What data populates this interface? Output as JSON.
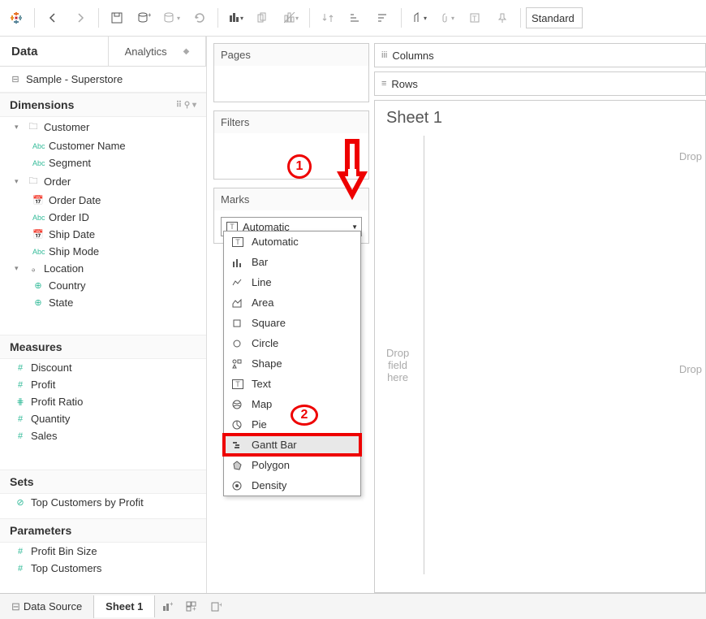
{
  "toolbar": {
    "style_select": "Standard"
  },
  "side": {
    "tabs": {
      "data": "Data",
      "analytics": "Analytics"
    },
    "datasource": "Sample - Superstore",
    "dimensions_label": "Dimensions",
    "dimensions": {
      "customer": "Customer",
      "customer_name": "Customer Name",
      "segment": "Segment",
      "order": "Order",
      "order_date": "Order Date",
      "order_id": "Order ID",
      "ship_date": "Ship Date",
      "ship_mode": "Ship Mode",
      "location": "Location",
      "country": "Country",
      "state": "State"
    },
    "measures_label": "Measures",
    "measures": {
      "discount": "Discount",
      "profit": "Profit",
      "profit_ratio": "Profit Ratio",
      "quantity": "Quantity",
      "sales": "Sales"
    },
    "sets_label": "Sets",
    "sets": {
      "top_cust": "Top Customers by Profit"
    },
    "params_label": "Parameters",
    "params": {
      "profit_bin": "Profit Bin Size",
      "top_cust": "Top Customers"
    }
  },
  "shelves": {
    "pages": "Pages",
    "filters": "Filters",
    "marks": "Marks",
    "marks_sel": "Automatic",
    "columns": "Columns",
    "rows": "Rows"
  },
  "marks_menu": {
    "automatic": "Automatic",
    "bar": "Bar",
    "line": "Line",
    "area": "Area",
    "square": "Square",
    "circle": "Circle",
    "shape": "Shape",
    "text": "Text",
    "map": "Map",
    "pie": "Pie",
    "gantt": "Gantt Bar",
    "polygon": "Polygon",
    "density": "Density"
  },
  "canvas": {
    "title": "Sheet 1",
    "drop_left": "Drop\nfield\nhere",
    "drop_right": "Drop"
  },
  "footer": {
    "datasource": "Data Source",
    "sheet1": "Sheet 1"
  },
  "annotations": {
    "one": "1",
    "two": "2"
  }
}
